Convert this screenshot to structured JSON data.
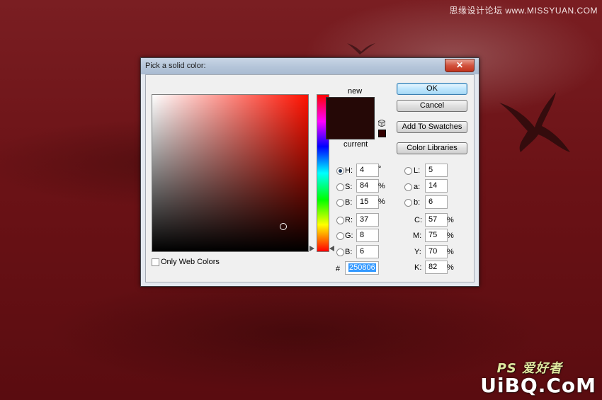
{
  "watermark_top": "思缘设计论坛 www.MISSYUAN.COM",
  "watermark_bottom": "UiBQ.CoM",
  "watermark_ps": "PS 爱好者",
  "dialog": {
    "title": "Pick a solid color:",
    "close_label": "✕",
    "new_label": "new",
    "current_label": "current",
    "new_color": "#250806",
    "current_color": "#250806",
    "buttons": {
      "ok": "OK",
      "cancel": "Cancel",
      "add_to_swatches": "Add To Swatches",
      "color_libraries": "Color Libraries"
    },
    "only_web_colors": "Only Web Colors",
    "hsb": [
      {
        "label": "H:",
        "value": "4",
        "unit": "°",
        "selected": true
      },
      {
        "label": "S:",
        "value": "84",
        "unit": "%",
        "selected": false
      },
      {
        "label": "B:",
        "value": "15",
        "unit": "%",
        "selected": false
      }
    ],
    "rgb": [
      {
        "label": "R:",
        "value": "37"
      },
      {
        "label": "G:",
        "value": "8"
      },
      {
        "label": "B:",
        "value": "6"
      }
    ],
    "lab": [
      {
        "label": "L:",
        "value": "5"
      },
      {
        "label": "a:",
        "value": "14"
      },
      {
        "label": "b:",
        "value": "6"
      }
    ],
    "cmyk": [
      {
        "label": "C:",
        "value": "57",
        "unit": "%"
      },
      {
        "label": "M:",
        "value": "75",
        "unit": "%"
      },
      {
        "label": "Y:",
        "value": "70",
        "unit": "%"
      },
      {
        "label": "K:",
        "value": "82",
        "unit": "%"
      }
    ],
    "hex_label": "#",
    "hex_value": "250806",
    "field_hue_color": "#ff1100"
  }
}
